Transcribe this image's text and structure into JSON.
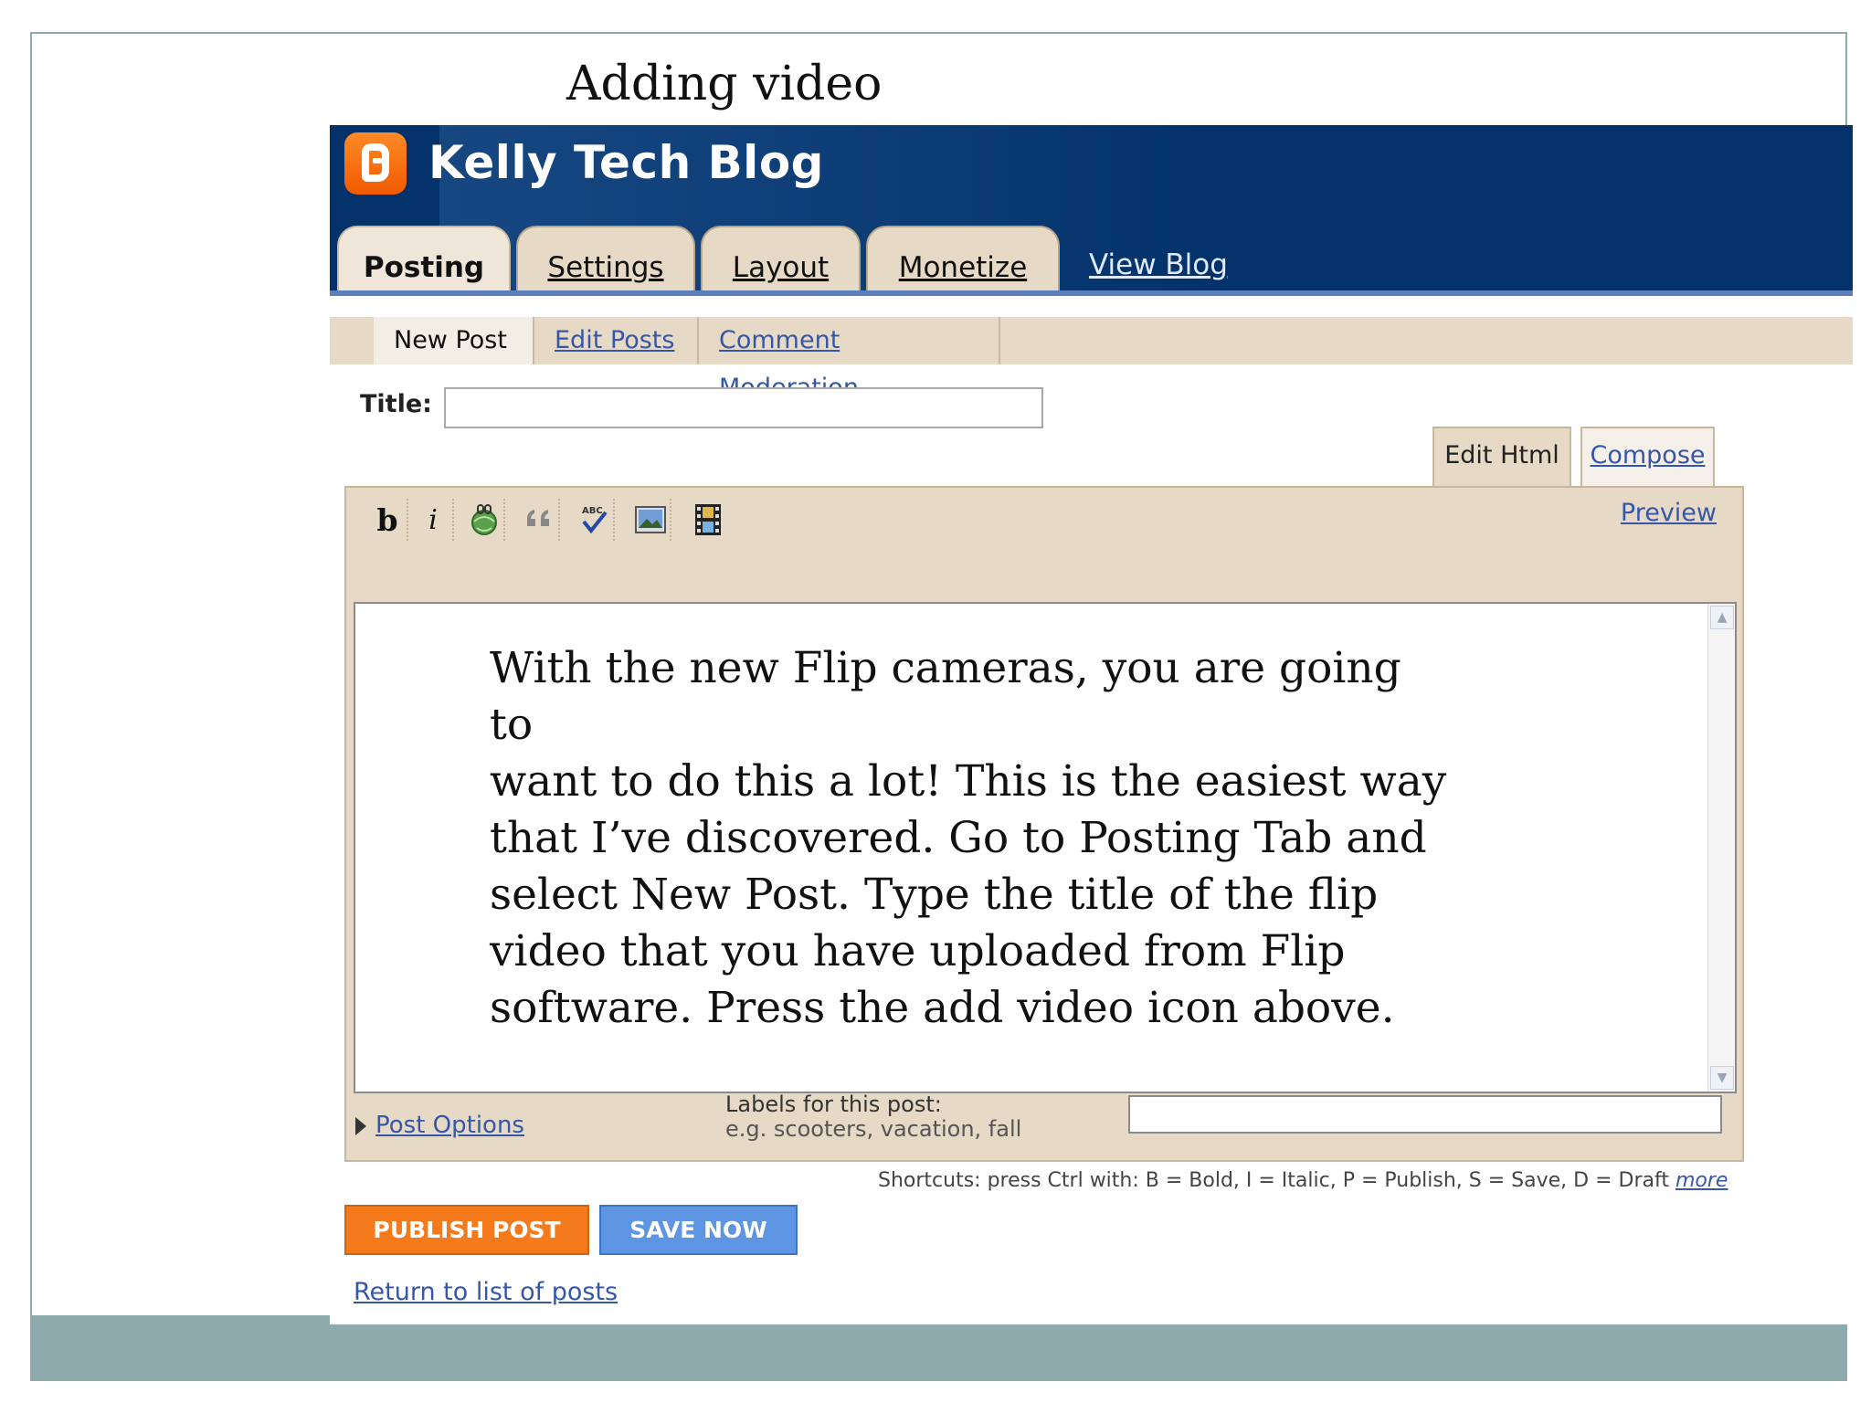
{
  "slide": {
    "title": "Adding video"
  },
  "blog": {
    "name": "Kelly Tech Blog"
  },
  "main_tabs": [
    {
      "label": "Posting",
      "active": true
    },
    {
      "label": "Settings"
    },
    {
      "label": "Layout"
    },
    {
      "label": "Monetize"
    }
  ],
  "view_blog": "View Blog",
  "sub_tabs": [
    {
      "label": "New Post",
      "active": true
    },
    {
      "label": "Edit Posts"
    },
    {
      "label": "Comment Moderation"
    }
  ],
  "title_field": {
    "label": "Title:",
    "value": ""
  },
  "mode_tabs": {
    "edit_html": "Edit Html",
    "compose": "Compose"
  },
  "toolbar": {
    "bold": "b",
    "italic": "i",
    "icons": [
      "link-icon",
      "blockquote-icon",
      "spellcheck-icon",
      "add-image-icon",
      "add-video-icon"
    ],
    "preview": "Preview"
  },
  "editor": {
    "body": [
      "With the new Flip cameras, you are going to",
      "want to do this a lot!  This is the easiest way",
      "that I’ve discovered.  Go to Posting Tab and",
      "select New Post.  Type the title of the flip",
      "video that you have uploaded from Flip",
      "software.  Press the add video icon above."
    ]
  },
  "post_options": "Post Options",
  "labels": {
    "label": "Labels for this post:",
    "hint": "e.g. scooters, vacation, fall",
    "value": ""
  },
  "shortcuts": {
    "text": "Shortcuts: press Ctrl with: B = Bold, I = Italic, P = Publish, S = Save, D = Draft",
    "more": "more"
  },
  "buttons": {
    "publish": "PUBLISH POST",
    "save": "SAVE NOW"
  },
  "return_link": "Return to list of posts",
  "colors": {
    "header_bg": "#03326a",
    "tab_bg": "#e6d9c6",
    "link": "#3657a8",
    "publish": "#f57a1c",
    "save": "#5d95e2",
    "slide_accent": "#8eaaaa"
  }
}
